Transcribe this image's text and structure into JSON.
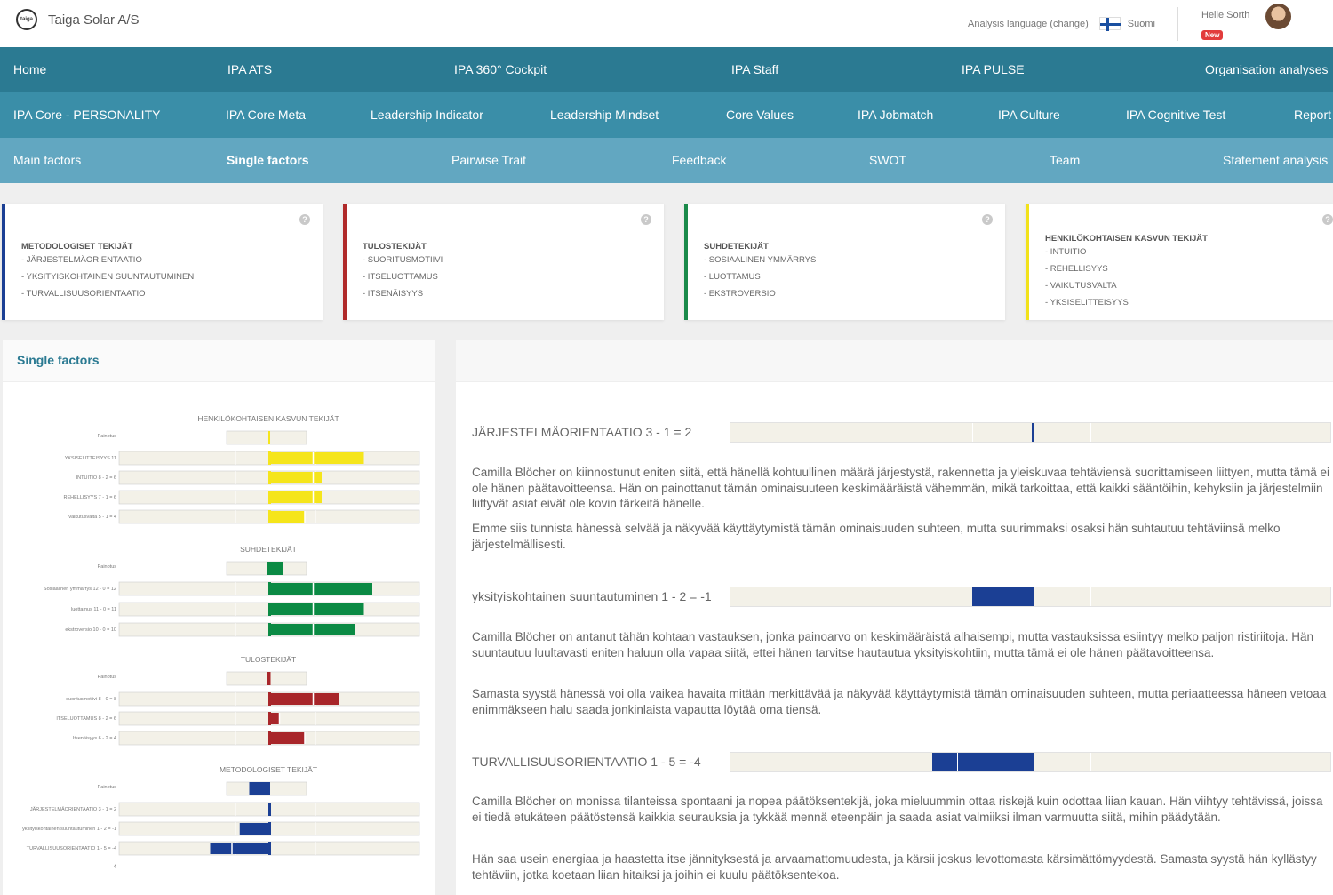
{
  "header": {
    "company": "Taiga Solar A/S",
    "logo_text": "taiga",
    "analysis_language": "Analysis language (change)",
    "language": "Suomi",
    "user_name": "Helle Sorth",
    "new_badge": "New"
  },
  "nav": {
    "row1": [
      "Home",
      "IPA ATS",
      "IPA 360° Cockpit",
      "IPA Staff",
      "IPA PULSE",
      "Organisation analyses"
    ],
    "row2": [
      "IPA Core - PERSONALITY",
      "IPA Core Meta",
      "Leadership Indicator",
      "Leadership Mindset",
      "Core Values",
      "IPA Jobmatch",
      "IPA Culture",
      "IPA Cognitive Test",
      "Report"
    ],
    "row3": [
      "Main factors",
      "Single factors",
      "Pairwise Trait",
      "Feedback",
      "SWOT",
      "Team",
      "Statement analysis"
    ],
    "active": "Single factors"
  },
  "cards": [
    {
      "title": "METODOLOGISET TEKIJÄT",
      "color": "#1b3f94",
      "items": [
        "- JÄRJESTELMÄORIENTAATIO",
        "- YKSITYISKOHTAINEN SUUNTAUTUMINEN",
        "- TURVALLISUUSORIENTAATIO"
      ]
    },
    {
      "title": "TULOSTEKIJÄT",
      "color": "#b02a2a",
      "items": [
        "- SUORITUSMOTIIVI",
        "- ITSELUOTTAMUS",
        "- ITSENÄISYYS"
      ]
    },
    {
      "title": "SUHDETEKIJÄT",
      "color": "#1a8a4a",
      "items": [
        "- SOSIAALINEN YMMÄRRYS",
        "- LUOTTAMUS",
        "- EKSTROVERSIO"
      ]
    },
    {
      "title": "HENKILÖKOHTAISEN KASVUN TEKIJÄT",
      "color": "#f2e21a",
      "items": [
        "- INTUITIO",
        "- REHELLISYYS",
        "- VAIKUTUSVALTA",
        "- YKSISELITTEISYYS"
      ]
    }
  ],
  "left_panel": {
    "title": "Single factors",
    "axis_min_label": "-4",
    "groups": [
      {
        "title": "HENKILÖKOHTAISEN KASVUN TEKIJÄT",
        "color": "#f5e51b",
        "painotus": "Painotus",
        "painotus_value": 0,
        "rows": [
          {
            "label": "YKSISELITTEISYYS 11",
            "value": 11
          },
          {
            "label": "INTUITIO 8 - 2 = 6",
            "value": 6
          },
          {
            "label": "REHELLISYYS 7 - 1 = 6",
            "value": 6
          },
          {
            "label": "Vaikutusvalta 5 - 1 = 4",
            "value": 4
          }
        ]
      },
      {
        "title": "SUHDETEKIJÄT",
        "color": "#0b8a44",
        "painotus": "Painotus",
        "painotus_value": 1,
        "rows": [
          {
            "label": "Sosiaalinen ymmärrys 12 - 0 = 12",
            "value": 12
          },
          {
            "label": "luottamus 11 - 0 = 11",
            "value": 11
          },
          {
            "label": "ekstroversio 10 - 0 = 10",
            "value": 10
          }
        ]
      },
      {
        "title": "TULOSTEKIJÄT",
        "color": "#a8262a",
        "painotus": "Painotus",
        "painotus_value": 0.1,
        "rows": [
          {
            "label": "suoritusmotiivi 8 - 0 = 8",
            "value": 8
          },
          {
            "label": "ITSELUOTTAMUS 8 - 2 = 6",
            "value": 1
          },
          {
            "label": "Itsenäisyys 6 - 2 = 4",
            "value": 4
          }
        ]
      },
      {
        "title": "METODOLOGISET TEKIJÄT",
        "color": "#1b3f94",
        "painotus": "Painotus",
        "painotus_value": -1.5,
        "rows": [
          {
            "label": "JÄRJESTELMÄORIENTAATIO 3 - 1 = 2",
            "value": 0
          },
          {
            "label": "yksityiskohtainen suuntautuminen 1 - 2 = -1",
            "value": -2
          },
          {
            "label": "TURVALLISUUSORIENTAATIO 1 - 5 = -4",
            "value": -4
          }
        ]
      }
    ]
  },
  "factors": [
    {
      "label": "JÄRJESTELMÄORIENTAATIO 3 - 1 = 2",
      "value": 0,
      "paragraphs": [
        "Camilla Blöcher on kiinnostunut eniten siitä, että hänellä kohtuullinen määrä järjestystä, rakennetta ja yleiskuvaa tehtäviensä suorittamiseen liittyen, mutta tämä ei ole hänen päätavoitteensa. Hän on painottanut tämän ominaisuuteen keskimääräistä vähemmän, mikä tarkoittaa, että kaikki sääntöihin, kehyksiin ja järjestelmiin liittyvät asiat eivät ole kovin tärkeitä hänelle.",
        "Emme siis tunnista hänessä selvää ja näkyvää käyttäytymistä tämän ominaisuuden suhteen, mutta suurimmaksi osaksi hän suhtautuu tehtäviinsä melko järjestelmällisesti."
      ]
    },
    {
      "label": "yksityiskohtainen suuntautuminen 1 - 2 = -1",
      "value": -1.5,
      "paragraphs": [
        "Camilla Blöcher on antanut tähän kohtaan vastauksen, jonka painoarvo on keskimääräistä alhaisempi, mutta vastauksissa esiintyy melko paljon ristiriitoja. Hän suuntautuu luultavasti eniten haluun olla vapaa siitä, ettei hänen tarvitse hautautua yksityiskohtiin, mutta tämä ei ole hänen päätavoitteensa.",
        "Samasta syystä hänessä voi olla vaikea havaita mitään merkittävää ja näkyvää käyttäytymistä tämän ominaisuuden suhteen, mutta periaatteessa häneen vetoaa enimmäkseen halu saada jonkinlaista vapautta löytää oma tiensä."
      ]
    },
    {
      "label": "TURVALLISUUSORIENTAATIO 1 - 5 = -4",
      "value": -2.5,
      "paragraphs": [
        "Camilla Blöcher on monissa tilanteissa spontaani ja nopea päätöksentekijä, joka mieluummin ottaa riskejä kuin odottaa liian kauan. Hän viihtyy tehtävissä, joissa ei tiedä etukäteen päätöstensä kaikkia seurauksia ja tykkää mennä eteenpäin ja saada asiat valmiiksi ilman varmuutta siitä, mihin päädytään.",
        "Hän saa usein energiaa ja haastetta itse jännityksestä ja arvaamattomuudesta, ja kärsii joskus levottomasta kärsimättömyydestä. Samasta syystä hän kyllästyy tehtäviin, jotka koetaan liian hitaiksi ja joihin ei kuulu päätöksentekoa."
      ]
    }
  ]
}
